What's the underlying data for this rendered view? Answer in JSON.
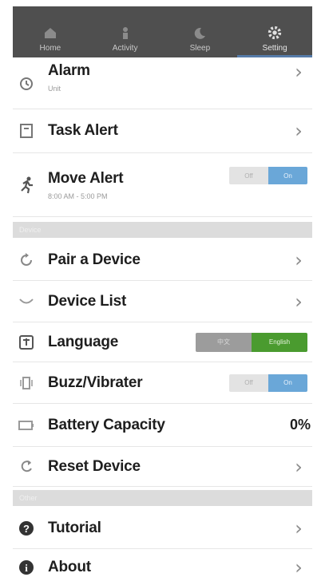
{
  "tabs": [
    {
      "label": "Home",
      "icon": "home-icon",
      "active": false
    },
    {
      "label": "Activity",
      "icon": "activity-icon",
      "active": false
    },
    {
      "label": "Sleep",
      "icon": "sleep-icon",
      "active": false
    },
    {
      "label": "Setting",
      "icon": "gear-icon",
      "active": true
    }
  ],
  "alarm": {
    "label": "Alarm",
    "sub": "Unit"
  },
  "task_alert": {
    "label": "Task Alert"
  },
  "move_alert": {
    "label": "Move Alert",
    "sub": "8:00 AM - 5:00 PM",
    "toggle_off": "Off",
    "toggle_on": "On"
  },
  "section_device": {
    "label": "Device"
  },
  "pair_device": {
    "label": "Pair a Device"
  },
  "device_list": {
    "label": "Device List"
  },
  "language": {
    "label": "Language",
    "option_left": "中文",
    "option_right": "English"
  },
  "buzz": {
    "label": "Buzz/Vibrater",
    "toggle_off": "Off",
    "toggle_on": "On"
  },
  "battery": {
    "label": "Battery Capacity",
    "value": "0%"
  },
  "reset": {
    "label": "Reset Device"
  },
  "section_other": {
    "label": "Other"
  },
  "tutorial": {
    "label": "Tutorial"
  },
  "about": {
    "label": "About"
  },
  "colors": {
    "tabbar": "#4f4f4f",
    "toggle_on": "#6aa7d8",
    "lang_selected": "#4a9b2f",
    "section_bg": "#dcdcdc"
  }
}
